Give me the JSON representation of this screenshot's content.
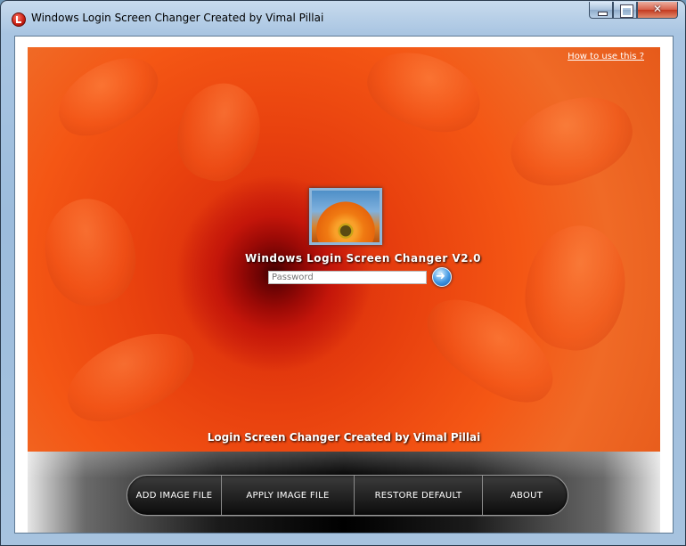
{
  "window": {
    "title": "Windows Login Screen Changer Created by Vimal Pillai"
  },
  "preview": {
    "help_link": "How to use this ?",
    "app_title": "Windows Login Screen Changer V2.0",
    "password_placeholder": "Password",
    "credit": "Login Screen Changer Created by Vimal Pillai"
  },
  "toolbar": {
    "add_image_label": "ADD IMAGE FILE",
    "apply_image_label": "APPLY IMAGE FILE",
    "restore_default_label": "RESTORE DEFAULT",
    "about_label": "ABOUT"
  },
  "icons": {
    "app": "app-logo-icon",
    "go": "arrow-right-icon",
    "minimize": "minimize-icon",
    "maximize": "maximize-icon",
    "close": "close-icon"
  },
  "colors": {
    "accent_orange": "#f2561a",
    "button_bar": "#1a1a1a",
    "title_bar": "#a9c5e2"
  }
}
